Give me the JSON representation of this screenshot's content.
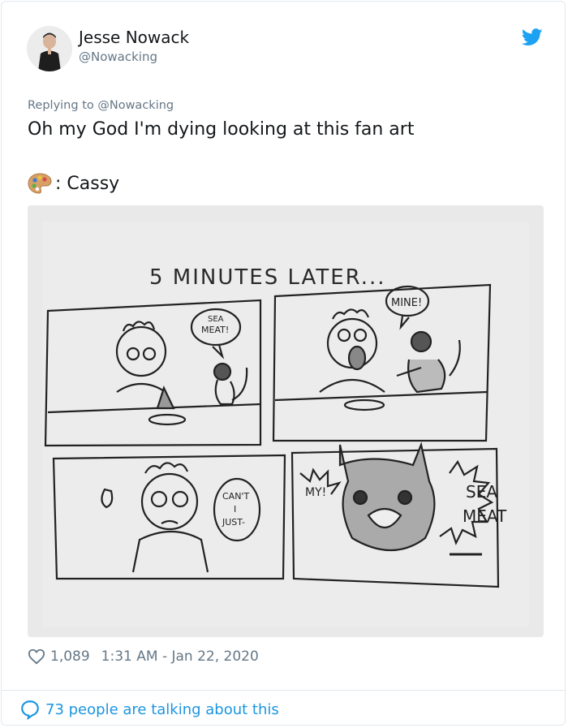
{
  "user": {
    "name": "Jesse Nowack",
    "handle": "@Nowacking"
  },
  "tweet": {
    "reply_to": "Replying to @Nowacking",
    "text": "Oh my God I'm dying looking at this fan art",
    "credit": ": Cassy",
    "likes": "1,089",
    "timestamp": "1:31 AM - Jan 22, 2020"
  },
  "comic": {
    "title": "5 MINUTES LATER...",
    "panel1_bubble": [
      "SEA",
      "MEAT!"
    ],
    "panel2_bubble": "MINE!",
    "panel3_bubble": [
      "CAN'T",
      "I",
      "JUST-"
    ],
    "panel4_left": "MY!",
    "panel4_right": [
      "SEA",
      "MEAT"
    ]
  },
  "footer": {
    "talking": "73 people are talking about this"
  },
  "colors": {
    "link": "#1b95e0",
    "muted": "#657786",
    "twitter_blue": "#1da1f2"
  },
  "icons": [
    "avatar",
    "twitter-bird-icon",
    "palette-icon",
    "heart-icon",
    "comment-bubble-icon"
  ]
}
